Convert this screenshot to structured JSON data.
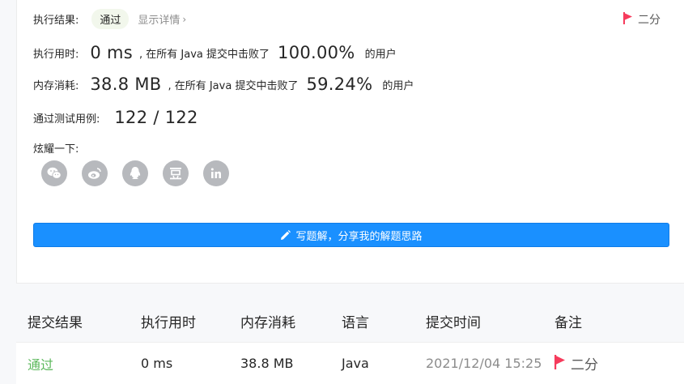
{
  "result": {
    "label": "执行结果:",
    "status": "通过",
    "details_link": "显示详情",
    "difficulty": "二分"
  },
  "runtime": {
    "label": "执行用时:",
    "value": "0 ms",
    "beat_text": ", 在所有 Java 提交中击败了",
    "percent": "100.00%",
    "suffix": "的用户"
  },
  "memory": {
    "label": "内存消耗:",
    "value": "38.8 MB",
    "beat_text": ", 在所有 Java 提交中击败了",
    "percent": "59.24%",
    "suffix": "的用户"
  },
  "tests": {
    "label": "通过测试用例:",
    "value": "122 / 122"
  },
  "share": {
    "label": "炫耀一下:",
    "icons": [
      "wechat-icon",
      "weibo-icon",
      "qq-icon",
      "douban-icon",
      "linkedin-icon"
    ]
  },
  "write_button": "写题解，分享我的解题思路",
  "table": {
    "headers": [
      "提交结果",
      "执行用时",
      "内存消耗",
      "语言",
      "提交时间",
      "备注"
    ],
    "rows": [
      {
        "result": "通过",
        "runtime": "0 ms",
        "memory": "38.8 MB",
        "language": "Java",
        "time": "2021/12/04 15:25",
        "note": "二分"
      }
    ]
  },
  "colors": {
    "accent": "#1a90ff",
    "success": "#5cb85c",
    "flag": "#f63b5c"
  }
}
